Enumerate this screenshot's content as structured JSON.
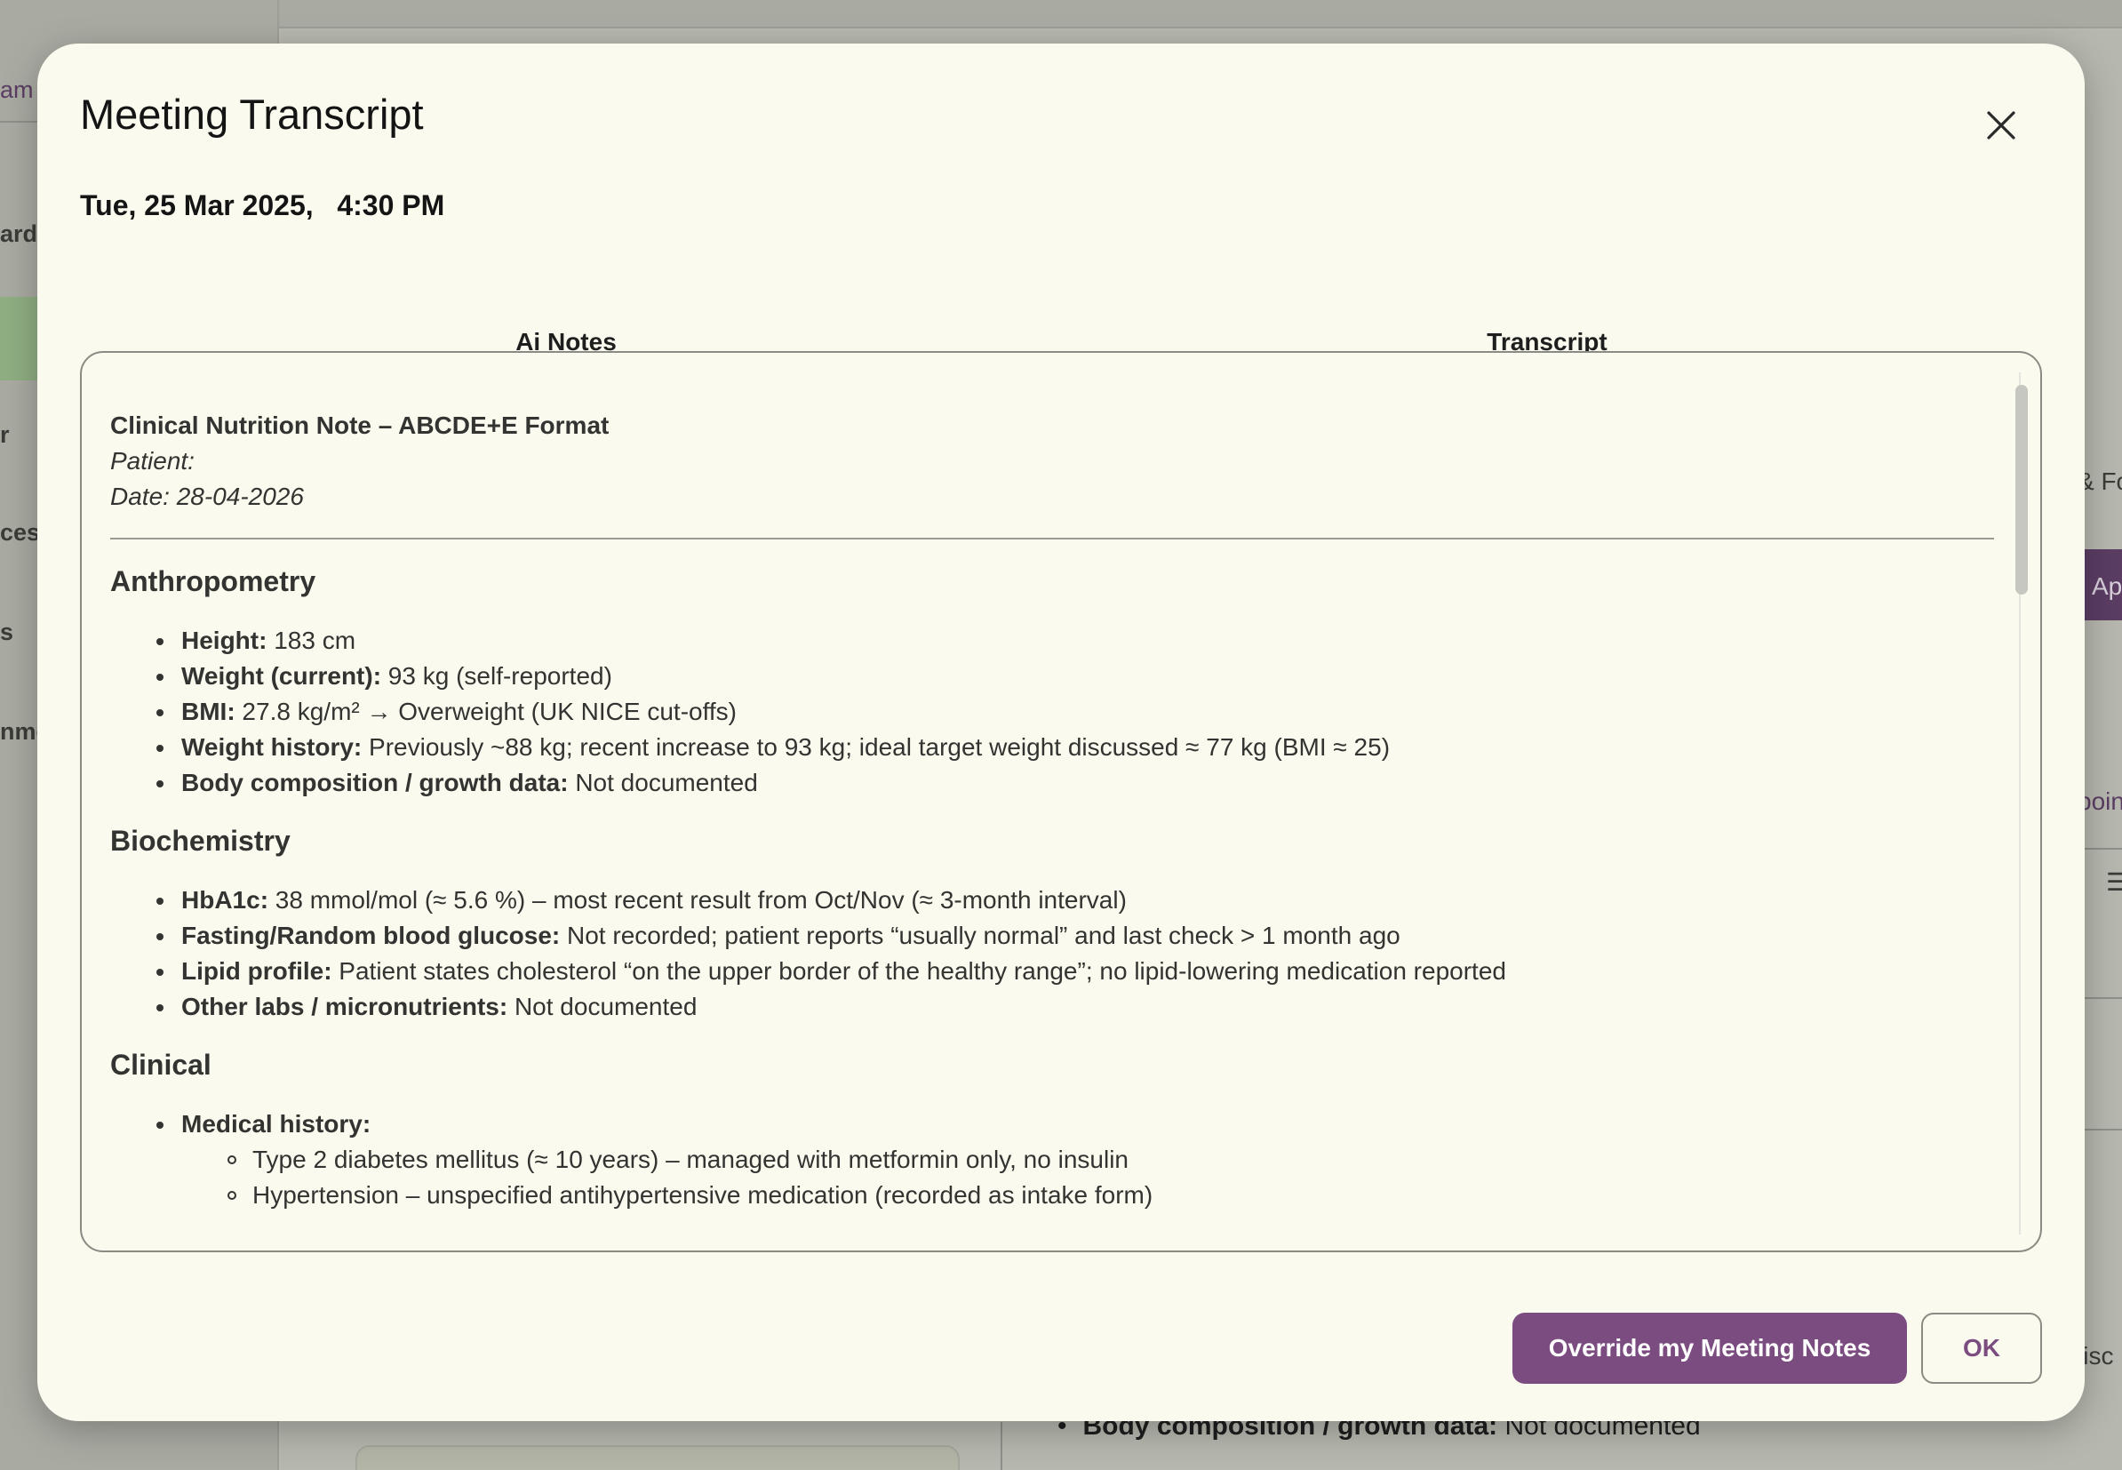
{
  "background": {
    "sidebar_items": [
      "am",
      "ard",
      "r",
      "ces",
      "s",
      "nme"
    ],
    "right_fragments": [
      "& Fo",
      "Appo",
      "poin",
      "lisc"
    ],
    "bottom_bullet": {
      "label": "Body composition / growth data:",
      "value": " Not documented"
    }
  },
  "modal": {
    "title": "Meeting Transcript",
    "date": "Tue, 25 Mar 2025,",
    "time": "4:30 PM",
    "tabs": [
      {
        "label": "Ai Notes",
        "active": true
      },
      {
        "label": "Transcript",
        "active": false
      }
    ],
    "notes": {
      "title": "Clinical Nutrition Note – ABCDE+E Format",
      "patient": "Patient:",
      "date": "Date: 28-04-2026",
      "sections": {
        "anthropometry": {
          "heading": "Anthropometry",
          "items": [
            {
              "label": "Height:",
              "value": " 183 cm"
            },
            {
              "label": "Weight (current):",
              "value": " 93 kg (self-reported)"
            },
            {
              "label": "BMI:",
              "value": " 27.8 kg/m² → Overweight (UK NICE cut-offs)"
            },
            {
              "label": "Weight history:",
              "value": " Previously ~88 kg; recent increase to 93 kg; ideal target weight discussed ≈ 77 kg (BMI ≈ 25)"
            },
            {
              "label": "Body composition / growth data:",
              "value": " Not documented"
            }
          ]
        },
        "biochemistry": {
          "heading": "Biochemistry",
          "items": [
            {
              "label": "HbA1c:",
              "value": " 38 mmol/mol (≈ 5.6 %) – most recent result from Oct/Nov (≈ 3-month interval)"
            },
            {
              "label": "Fasting/Random blood glucose:",
              "value": " Not recorded; patient reports “usually normal” and last check > 1 month ago"
            },
            {
              "label": "Lipid profile:",
              "value": " Patient states cholesterol “on the upper border of the healthy range”; no lipid-lowering medication reported"
            },
            {
              "label": "Other labs / micronutrients:",
              "value": " Not documented"
            }
          ]
        },
        "clinical": {
          "heading": "Clinical",
          "items": [
            {
              "label": "Medical history:",
              "value": ""
            }
          ],
          "sub_items": [
            "Type 2 diabetes mellitus (≈ 10 years) – managed with metformin only, no insulin",
            "Hypertension – unspecified antihypertensive medication (recorded as intake form)"
          ]
        }
      }
    },
    "buttons": {
      "override": "Override my Meeting Notes",
      "ok": "OK"
    },
    "colors": {
      "accent": "#7b4c80",
      "modal_bg": "#fafaee"
    }
  }
}
